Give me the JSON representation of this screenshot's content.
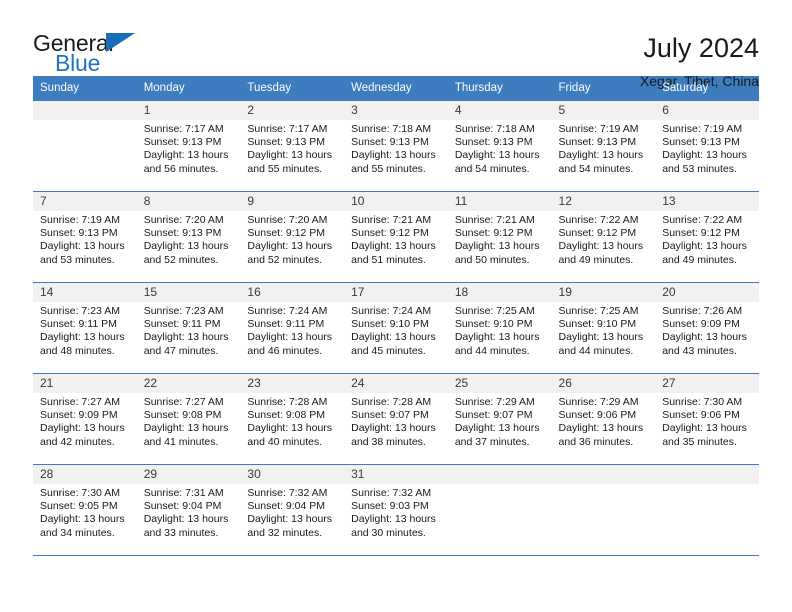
{
  "brand": {
    "name_top": "General",
    "name_bottom": "Blue",
    "flag_icon": "blue-triangle-flag",
    "accent_color": "#2175c0"
  },
  "header": {
    "title": "July 2024",
    "subtitle": "Xegar, Tibet, China"
  },
  "colors": {
    "header_band": "#3c7cbf",
    "daynum_background": "#f1f1f1",
    "text": "#1a1a1a"
  },
  "weekday_headers": [
    "Sunday",
    "Monday",
    "Tuesday",
    "Wednesday",
    "Thursday",
    "Friday",
    "Saturday"
  ],
  "weeks": [
    [
      {
        "day": "",
        "sunrise": "",
        "sunset": "",
        "daylight_1": "",
        "daylight_2": ""
      },
      {
        "day": "1",
        "sunrise": "Sunrise: 7:17 AM",
        "sunset": "Sunset: 9:13 PM",
        "daylight_1": "Daylight: 13 hours",
        "daylight_2": "and 56 minutes."
      },
      {
        "day": "2",
        "sunrise": "Sunrise: 7:17 AM",
        "sunset": "Sunset: 9:13 PM",
        "daylight_1": "Daylight: 13 hours",
        "daylight_2": "and 55 minutes."
      },
      {
        "day": "3",
        "sunrise": "Sunrise: 7:18 AM",
        "sunset": "Sunset: 9:13 PM",
        "daylight_1": "Daylight: 13 hours",
        "daylight_2": "and 55 minutes."
      },
      {
        "day": "4",
        "sunrise": "Sunrise: 7:18 AM",
        "sunset": "Sunset: 9:13 PM",
        "daylight_1": "Daylight: 13 hours",
        "daylight_2": "and 54 minutes."
      },
      {
        "day": "5",
        "sunrise": "Sunrise: 7:19 AM",
        "sunset": "Sunset: 9:13 PM",
        "daylight_1": "Daylight: 13 hours",
        "daylight_2": "and 54 minutes."
      },
      {
        "day": "6",
        "sunrise": "Sunrise: 7:19 AM",
        "sunset": "Sunset: 9:13 PM",
        "daylight_1": "Daylight: 13 hours",
        "daylight_2": "and 53 minutes."
      }
    ],
    [
      {
        "day": "7",
        "sunrise": "Sunrise: 7:19 AM",
        "sunset": "Sunset: 9:13 PM",
        "daylight_1": "Daylight: 13 hours",
        "daylight_2": "and 53 minutes."
      },
      {
        "day": "8",
        "sunrise": "Sunrise: 7:20 AM",
        "sunset": "Sunset: 9:13 PM",
        "daylight_1": "Daylight: 13 hours",
        "daylight_2": "and 52 minutes."
      },
      {
        "day": "9",
        "sunrise": "Sunrise: 7:20 AM",
        "sunset": "Sunset: 9:12 PM",
        "daylight_1": "Daylight: 13 hours",
        "daylight_2": "and 52 minutes."
      },
      {
        "day": "10",
        "sunrise": "Sunrise: 7:21 AM",
        "sunset": "Sunset: 9:12 PM",
        "daylight_1": "Daylight: 13 hours",
        "daylight_2": "and 51 minutes."
      },
      {
        "day": "11",
        "sunrise": "Sunrise: 7:21 AM",
        "sunset": "Sunset: 9:12 PM",
        "daylight_1": "Daylight: 13 hours",
        "daylight_2": "and 50 minutes."
      },
      {
        "day": "12",
        "sunrise": "Sunrise: 7:22 AM",
        "sunset": "Sunset: 9:12 PM",
        "daylight_1": "Daylight: 13 hours",
        "daylight_2": "and 49 minutes."
      },
      {
        "day": "13",
        "sunrise": "Sunrise: 7:22 AM",
        "sunset": "Sunset: 9:12 PM",
        "daylight_1": "Daylight: 13 hours",
        "daylight_2": "and 49 minutes."
      }
    ],
    [
      {
        "day": "14",
        "sunrise": "Sunrise: 7:23 AM",
        "sunset": "Sunset: 9:11 PM",
        "daylight_1": "Daylight: 13 hours",
        "daylight_2": "and 48 minutes."
      },
      {
        "day": "15",
        "sunrise": "Sunrise: 7:23 AM",
        "sunset": "Sunset: 9:11 PM",
        "daylight_1": "Daylight: 13 hours",
        "daylight_2": "and 47 minutes."
      },
      {
        "day": "16",
        "sunrise": "Sunrise: 7:24 AM",
        "sunset": "Sunset: 9:11 PM",
        "daylight_1": "Daylight: 13 hours",
        "daylight_2": "and 46 minutes."
      },
      {
        "day": "17",
        "sunrise": "Sunrise: 7:24 AM",
        "sunset": "Sunset: 9:10 PM",
        "daylight_1": "Daylight: 13 hours",
        "daylight_2": "and 45 minutes."
      },
      {
        "day": "18",
        "sunrise": "Sunrise: 7:25 AM",
        "sunset": "Sunset: 9:10 PM",
        "daylight_1": "Daylight: 13 hours",
        "daylight_2": "and 44 minutes."
      },
      {
        "day": "19",
        "sunrise": "Sunrise: 7:25 AM",
        "sunset": "Sunset: 9:10 PM",
        "daylight_1": "Daylight: 13 hours",
        "daylight_2": "and 44 minutes."
      },
      {
        "day": "20",
        "sunrise": "Sunrise: 7:26 AM",
        "sunset": "Sunset: 9:09 PM",
        "daylight_1": "Daylight: 13 hours",
        "daylight_2": "and 43 minutes."
      }
    ],
    [
      {
        "day": "21",
        "sunrise": "Sunrise: 7:27 AM",
        "sunset": "Sunset: 9:09 PM",
        "daylight_1": "Daylight: 13 hours",
        "daylight_2": "and 42 minutes."
      },
      {
        "day": "22",
        "sunrise": "Sunrise: 7:27 AM",
        "sunset": "Sunset: 9:08 PM",
        "daylight_1": "Daylight: 13 hours",
        "daylight_2": "and 41 minutes."
      },
      {
        "day": "23",
        "sunrise": "Sunrise: 7:28 AM",
        "sunset": "Sunset: 9:08 PM",
        "daylight_1": "Daylight: 13 hours",
        "daylight_2": "and 40 minutes."
      },
      {
        "day": "24",
        "sunrise": "Sunrise: 7:28 AM",
        "sunset": "Sunset: 9:07 PM",
        "daylight_1": "Daylight: 13 hours",
        "daylight_2": "and 38 minutes."
      },
      {
        "day": "25",
        "sunrise": "Sunrise: 7:29 AM",
        "sunset": "Sunset: 9:07 PM",
        "daylight_1": "Daylight: 13 hours",
        "daylight_2": "and 37 minutes."
      },
      {
        "day": "26",
        "sunrise": "Sunrise: 7:29 AM",
        "sunset": "Sunset: 9:06 PM",
        "daylight_1": "Daylight: 13 hours",
        "daylight_2": "and 36 minutes."
      },
      {
        "day": "27",
        "sunrise": "Sunrise: 7:30 AM",
        "sunset": "Sunset: 9:06 PM",
        "daylight_1": "Daylight: 13 hours",
        "daylight_2": "and 35 minutes."
      }
    ],
    [
      {
        "day": "28",
        "sunrise": "Sunrise: 7:30 AM",
        "sunset": "Sunset: 9:05 PM",
        "daylight_1": "Daylight: 13 hours",
        "daylight_2": "and 34 minutes."
      },
      {
        "day": "29",
        "sunrise": "Sunrise: 7:31 AM",
        "sunset": "Sunset: 9:04 PM",
        "daylight_1": "Daylight: 13 hours",
        "daylight_2": "and 33 minutes."
      },
      {
        "day": "30",
        "sunrise": "Sunrise: 7:32 AM",
        "sunset": "Sunset: 9:04 PM",
        "daylight_1": "Daylight: 13 hours",
        "daylight_2": "and 32 minutes."
      },
      {
        "day": "31",
        "sunrise": "Sunrise: 7:32 AM",
        "sunset": "Sunset: 9:03 PM",
        "daylight_1": "Daylight: 13 hours",
        "daylight_2": "and 30 minutes."
      },
      {
        "day": "",
        "sunrise": "",
        "sunset": "",
        "daylight_1": "",
        "daylight_2": ""
      },
      {
        "day": "",
        "sunrise": "",
        "sunset": "",
        "daylight_1": "",
        "daylight_2": ""
      },
      {
        "day": "",
        "sunrise": "",
        "sunset": "",
        "daylight_1": "",
        "daylight_2": ""
      }
    ]
  ]
}
